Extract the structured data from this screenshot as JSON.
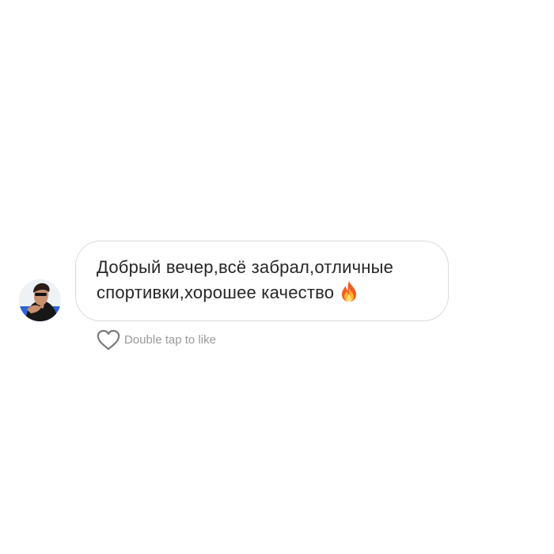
{
  "message": {
    "line_1": "Добрый вечер,всё забрал,отличные",
    "line_2": "спортивки,хорошее качество",
    "emoji": "fire-icon"
  },
  "like_hint": {
    "label": "Double tap to like",
    "icon": "heart-outline-icon"
  },
  "sender": {
    "avatar_icon": "avatar"
  },
  "colors": {
    "text": "#262626",
    "bubble_border": "#dbdbdb",
    "muted": "#9a9a9a",
    "background": "#ffffff"
  }
}
